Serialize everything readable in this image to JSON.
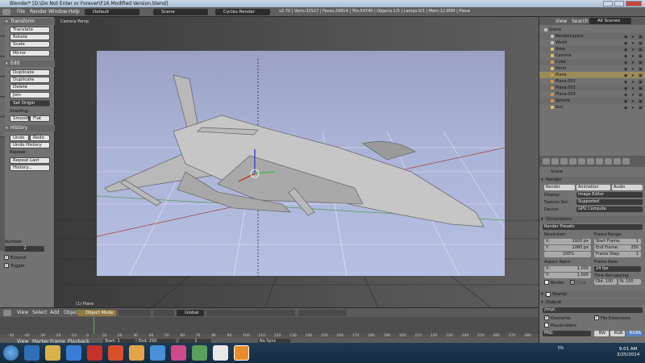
{
  "window": {
    "title": "Blender* [D:\\Do Not Enter or Forever\\F16 Modified Version.blend]"
  },
  "header": {
    "menus": [
      "File",
      "Render",
      "Window",
      "Help"
    ],
    "layout": "Default",
    "scene": "Scene",
    "engine": "Cycles Render",
    "stats": "v2.70 | Verts:32527 | Faces:29814 | Tris:54740 | Objects:1/5 | Lamps:0/1 | Mem:12.80M | Plane"
  },
  "toolshelf": {
    "transform_header": "Transform",
    "transform_buttons": [
      "Translate",
      "Rotate",
      "Scale",
      "Mirror"
    ],
    "edit_header": "Edit",
    "edit_buttons": [
      "Duplicate",
      "Duplicate Linked",
      "Delete",
      "Join"
    ],
    "set_origin": "Set Origin",
    "shading_label": "Shading:",
    "shading_buttons": [
      "Smooth",
      "Flat"
    ],
    "history_header": "History",
    "undo": "Undo",
    "redo": "Redo",
    "undo_history": "Undo History",
    "repeat_label": "Repeat:",
    "repeat_last": "Repeat Last",
    "history": "History...",
    "tabs": [
      "Tools",
      "Create",
      "Relations",
      "Animation",
      "Physics",
      "Grease Pencil"
    ],
    "op_number_label": "Number",
    "op_number_value": "2",
    "op_extend": "Extend",
    "op_toggle": "Toggle"
  },
  "viewport": {
    "camera_label": "Camera Persp",
    "object_label": "(1) Plane"
  },
  "view_header": {
    "menus": [
      "View",
      "Select",
      "Add",
      "Object"
    ],
    "mode": "Object Mode",
    "pivot": "Global"
  },
  "timeline": {
    "ticks": [
      "-50",
      "-40",
      "-30",
      "-20",
      "-10",
      "0",
      "10",
      "20",
      "30",
      "40",
      "50",
      "60",
      "70",
      "80",
      "90",
      "100",
      "110",
      "120",
      "130",
      "140",
      "150",
      "160",
      "170",
      "180",
      "190",
      "200",
      "210",
      "220",
      "230",
      "240",
      "250",
      "260",
      "270",
      "280"
    ],
    "menus": [
      "View",
      "Marker",
      "Frame",
      "Playback"
    ],
    "start": "Start:",
    "start_value": "1",
    "end": "End:",
    "end_value": "250",
    "current": "1",
    "sync": "No Sync"
  },
  "outliner": {
    "menus": [
      "View",
      "Search"
    ],
    "filter": "All Scenes",
    "items": [
      {
        "name": "Scene",
        "indent": 0,
        "color": "#c0c0c0"
      },
      {
        "name": "RenderLayers",
        "indent": 1,
        "color": "#c0c0c0"
      },
      {
        "name": "World",
        "indent": 1,
        "color": "#c0c0c0"
      },
      {
        "name": "Area",
        "indent": 1,
        "color": "#e0c060"
      },
      {
        "name": "Camera",
        "indent": 1,
        "color": "#e0c060"
      },
      {
        "name": "Cube",
        "indent": 1,
        "color": "#e09040"
      },
      {
        "name": "Hemi",
        "indent": 1,
        "color": "#e0c060"
      },
      {
        "name": "Plane",
        "indent": 1,
        "color": "#e09040"
      },
      {
        "name": "Plane.001",
        "indent": 1,
        "color": "#e09040"
      },
      {
        "name": "Plane.002",
        "indent": 1,
        "color": "#e09040"
      },
      {
        "name": "Plane.003",
        "indent": 1,
        "color": "#e09040"
      },
      {
        "name": "Sphere",
        "indent": 1,
        "color": "#e09040"
      },
      {
        "name": "Sun",
        "indent": 1,
        "color": "#e0c060"
      }
    ]
  },
  "properties": {
    "scene_label": "Scene",
    "render_header": "Render",
    "render_buttons": [
      "Render",
      "Animation",
      "Audio"
    ],
    "display_label": "Display:",
    "display_value": "Image Editor",
    "feature_label": "Feature Set:",
    "feature_value": "Supported",
    "device_label": "Device:",
    "device_value": "GPU Compute",
    "dimensions_header": "Dimensions",
    "presets": "Render Presets",
    "resolution_label": "Resolution:",
    "res_x": "X:",
    "res_x_value": "1920 px",
    "res_y": "Y:",
    "res_y_value": "1080 px",
    "res_pct": "100%",
    "frame_range_label": "Frame Range:",
    "start_frame": "Start Frame:",
    "start_frame_value": "1",
    "end_frame": "End Frame:",
    "end_frame_value": "250",
    "frame_step": "Frame Step:",
    "frame_step_value": "1",
    "aspect_label": "Aspect Ratio:",
    "aspect_x": "X:",
    "aspect_x_value": "1.000",
    "aspect_y": "Y:",
    "aspect_y_value": "1.000",
    "frame_rate_label": "Frame Rate:",
    "frame_rate_value": "24 fps",
    "time_remap_label": "Time Remapping:",
    "time_old": "Old: 100",
    "time_new": "N: 100",
    "border": "Border",
    "crop": "Crop",
    "stamp_header": "Stamp",
    "output_header": "Output",
    "output_path": "/tmp\\",
    "overwrite": "Overwrite",
    "file_extensions": "File Extensions",
    "placeholders": "Placeholders",
    "format": "PNG",
    "format_bw": "BW",
    "format_rgb": "RGB",
    "format_rgba": "RGBA"
  },
  "taskbar": {
    "tray": "EN",
    "time": "9:01 AM",
    "date": "3/25/2014"
  }
}
